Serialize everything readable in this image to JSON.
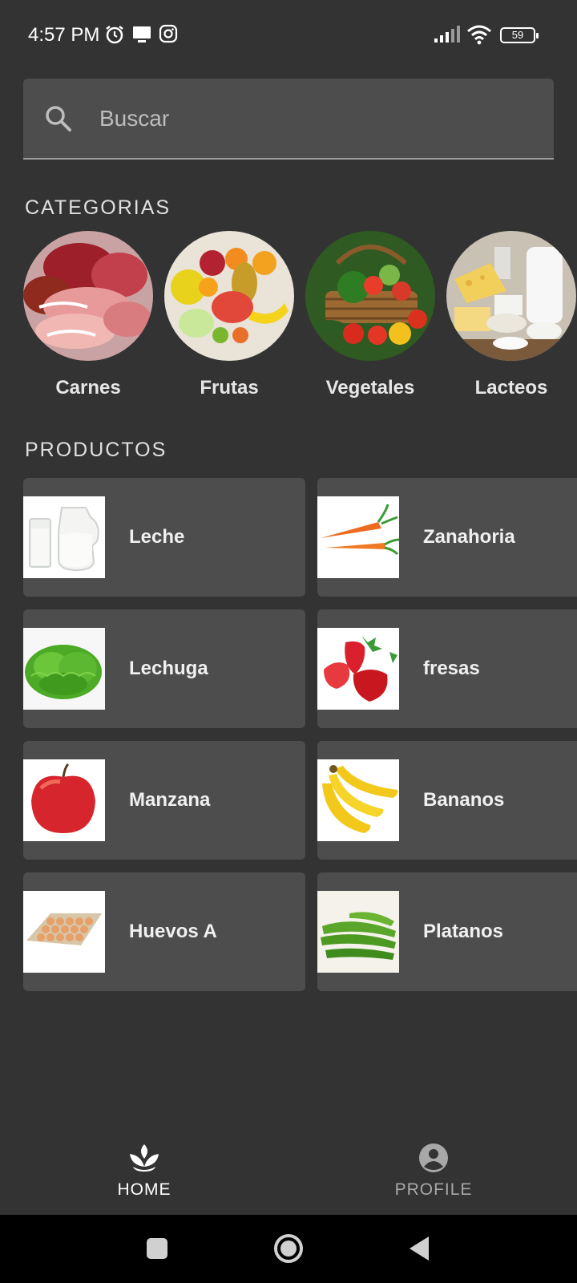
{
  "status_bar": {
    "time": "4:57 PM",
    "battery": "59",
    "icons": [
      "alarm-icon",
      "monitor-icon",
      "instagram-icon",
      "signal-icon",
      "wifi-icon",
      "battery-icon"
    ]
  },
  "search": {
    "placeholder": "Buscar",
    "value": "",
    "icon": "search-icon"
  },
  "categories": {
    "title": "CATEGORIAS",
    "items": [
      {
        "label": "Carnes"
      },
      {
        "label": "Frutas"
      },
      {
        "label": "Vegetales"
      },
      {
        "label": "Lacteos"
      }
    ]
  },
  "products": {
    "title": "PRODUCTOS",
    "items": [
      {
        "name": "Leche"
      },
      {
        "name": "Zanahoria"
      },
      {
        "name": "Lechuga"
      },
      {
        "name": "fresas"
      },
      {
        "name": "Manzana"
      },
      {
        "name": "Bananos"
      },
      {
        "name": "Huevos A"
      },
      {
        "name": "Platanos"
      }
    ]
  },
  "bottom_nav": {
    "home_label": "HOME",
    "profile_label": "PROFILE",
    "active": "home",
    "active_color": "#ffffff",
    "inactive_color": "#a8a8a8"
  },
  "colors": {
    "background": "#333333",
    "card": "#4d4d4d",
    "system_bar": "#000000"
  }
}
